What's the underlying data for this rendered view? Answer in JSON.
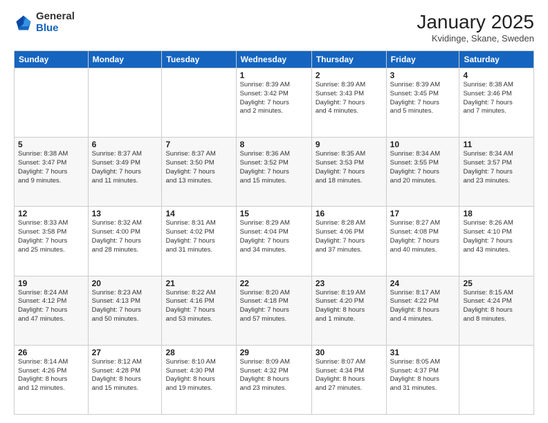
{
  "header": {
    "logo_general": "General",
    "logo_blue": "Blue",
    "title": "January 2025",
    "subtitle": "Kvidinge, Skane, Sweden"
  },
  "weekdays": [
    "Sunday",
    "Monday",
    "Tuesday",
    "Wednesday",
    "Thursday",
    "Friday",
    "Saturday"
  ],
  "weeks": [
    [
      {
        "day": "",
        "info": ""
      },
      {
        "day": "",
        "info": ""
      },
      {
        "day": "",
        "info": ""
      },
      {
        "day": "1",
        "info": "Sunrise: 8:39 AM\nSunset: 3:42 PM\nDaylight: 7 hours\nand 2 minutes."
      },
      {
        "day": "2",
        "info": "Sunrise: 8:39 AM\nSunset: 3:43 PM\nDaylight: 7 hours\nand 4 minutes."
      },
      {
        "day": "3",
        "info": "Sunrise: 8:39 AM\nSunset: 3:45 PM\nDaylight: 7 hours\nand 5 minutes."
      },
      {
        "day": "4",
        "info": "Sunrise: 8:38 AM\nSunset: 3:46 PM\nDaylight: 7 hours\nand 7 minutes."
      }
    ],
    [
      {
        "day": "5",
        "info": "Sunrise: 8:38 AM\nSunset: 3:47 PM\nDaylight: 7 hours\nand 9 minutes."
      },
      {
        "day": "6",
        "info": "Sunrise: 8:37 AM\nSunset: 3:49 PM\nDaylight: 7 hours\nand 11 minutes."
      },
      {
        "day": "7",
        "info": "Sunrise: 8:37 AM\nSunset: 3:50 PM\nDaylight: 7 hours\nand 13 minutes."
      },
      {
        "day": "8",
        "info": "Sunrise: 8:36 AM\nSunset: 3:52 PM\nDaylight: 7 hours\nand 15 minutes."
      },
      {
        "day": "9",
        "info": "Sunrise: 8:35 AM\nSunset: 3:53 PM\nDaylight: 7 hours\nand 18 minutes."
      },
      {
        "day": "10",
        "info": "Sunrise: 8:34 AM\nSunset: 3:55 PM\nDaylight: 7 hours\nand 20 minutes."
      },
      {
        "day": "11",
        "info": "Sunrise: 8:34 AM\nSunset: 3:57 PM\nDaylight: 7 hours\nand 23 minutes."
      }
    ],
    [
      {
        "day": "12",
        "info": "Sunrise: 8:33 AM\nSunset: 3:58 PM\nDaylight: 7 hours\nand 25 minutes."
      },
      {
        "day": "13",
        "info": "Sunrise: 8:32 AM\nSunset: 4:00 PM\nDaylight: 7 hours\nand 28 minutes."
      },
      {
        "day": "14",
        "info": "Sunrise: 8:31 AM\nSunset: 4:02 PM\nDaylight: 7 hours\nand 31 minutes."
      },
      {
        "day": "15",
        "info": "Sunrise: 8:29 AM\nSunset: 4:04 PM\nDaylight: 7 hours\nand 34 minutes."
      },
      {
        "day": "16",
        "info": "Sunrise: 8:28 AM\nSunset: 4:06 PM\nDaylight: 7 hours\nand 37 minutes."
      },
      {
        "day": "17",
        "info": "Sunrise: 8:27 AM\nSunset: 4:08 PM\nDaylight: 7 hours\nand 40 minutes."
      },
      {
        "day": "18",
        "info": "Sunrise: 8:26 AM\nSunset: 4:10 PM\nDaylight: 7 hours\nand 43 minutes."
      }
    ],
    [
      {
        "day": "19",
        "info": "Sunrise: 8:24 AM\nSunset: 4:12 PM\nDaylight: 7 hours\nand 47 minutes."
      },
      {
        "day": "20",
        "info": "Sunrise: 8:23 AM\nSunset: 4:13 PM\nDaylight: 7 hours\nand 50 minutes."
      },
      {
        "day": "21",
        "info": "Sunrise: 8:22 AM\nSunset: 4:16 PM\nDaylight: 7 hours\nand 53 minutes."
      },
      {
        "day": "22",
        "info": "Sunrise: 8:20 AM\nSunset: 4:18 PM\nDaylight: 7 hours\nand 57 minutes."
      },
      {
        "day": "23",
        "info": "Sunrise: 8:19 AM\nSunset: 4:20 PM\nDaylight: 8 hours\nand 1 minute."
      },
      {
        "day": "24",
        "info": "Sunrise: 8:17 AM\nSunset: 4:22 PM\nDaylight: 8 hours\nand 4 minutes."
      },
      {
        "day": "25",
        "info": "Sunrise: 8:15 AM\nSunset: 4:24 PM\nDaylight: 8 hours\nand 8 minutes."
      }
    ],
    [
      {
        "day": "26",
        "info": "Sunrise: 8:14 AM\nSunset: 4:26 PM\nDaylight: 8 hours\nand 12 minutes."
      },
      {
        "day": "27",
        "info": "Sunrise: 8:12 AM\nSunset: 4:28 PM\nDaylight: 8 hours\nand 15 minutes."
      },
      {
        "day": "28",
        "info": "Sunrise: 8:10 AM\nSunset: 4:30 PM\nDaylight: 8 hours\nand 19 minutes."
      },
      {
        "day": "29",
        "info": "Sunrise: 8:09 AM\nSunset: 4:32 PM\nDaylight: 8 hours\nand 23 minutes."
      },
      {
        "day": "30",
        "info": "Sunrise: 8:07 AM\nSunset: 4:34 PM\nDaylight: 8 hours\nand 27 minutes."
      },
      {
        "day": "31",
        "info": "Sunrise: 8:05 AM\nSunset: 4:37 PM\nDaylight: 8 hours\nand 31 minutes."
      },
      {
        "day": "",
        "info": ""
      }
    ]
  ]
}
